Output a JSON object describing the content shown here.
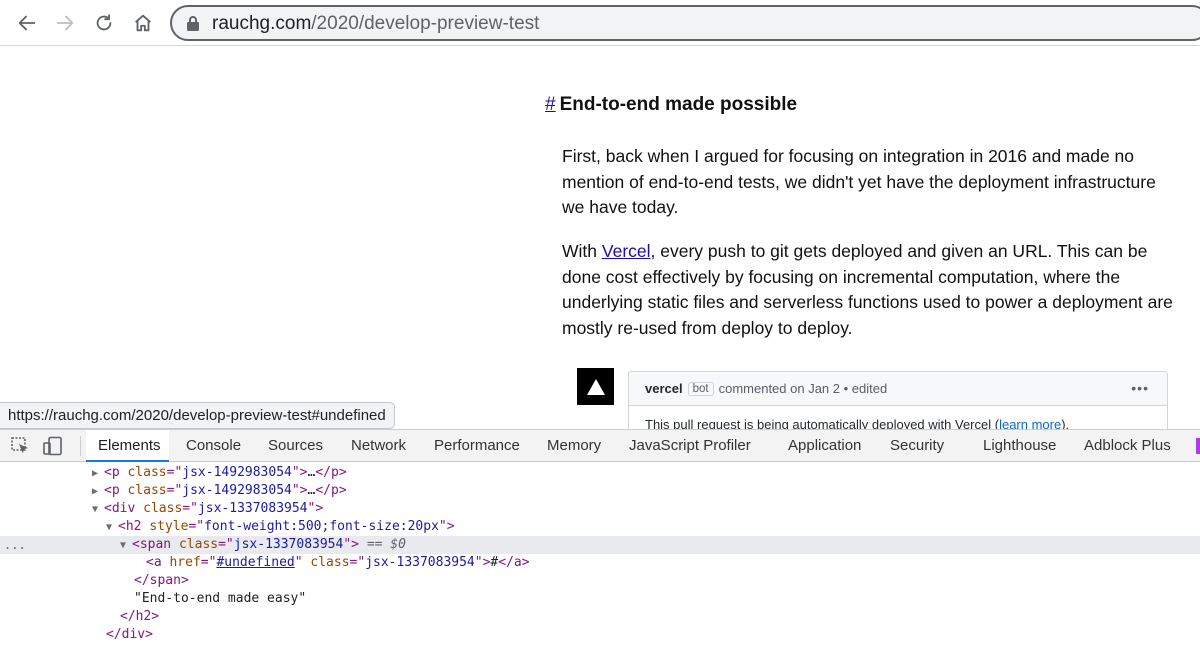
{
  "browser": {
    "url_host": "rauchg.com",
    "url_path": "/2020/develop-preview-test",
    "icons": [
      "back-arrow-icon",
      "forward-arrow-icon",
      "reload-icon",
      "home-icon",
      "lock-icon"
    ]
  },
  "article": {
    "anchor": "#",
    "heading": "End-to-end made possible",
    "p1": "First, back when I argued for focusing on integration in 2016 and made no mention of end-to-end tests, we didn't yet have the deployment infrastructure we have today.",
    "p2_prefix": "With ",
    "p2_link": "Vercel",
    "p2_rest": ", every push to git gets deployed and given an URL. This can be done cost effectively by focusing on incremental computation, where the underlying static files and serverless functions used to power a deployment are mostly re-used from deploy to deploy."
  },
  "comment": {
    "author": "vercel",
    "badge": "bot",
    "meta": "commented on Jan 2 • edited",
    "menu": "•••",
    "body": "This pull request is being automatically deployed with Vercel (",
    "body_link": "learn more",
    "body_end": ")."
  },
  "status_bar": {
    "hover_url": "https://rauchg.com/2020/develop-preview-test#undefined"
  },
  "devtools": {
    "tabs": [
      "Elements",
      "Console",
      "Sources",
      "Network",
      "Performance",
      "Memory",
      "JavaScript Profiler",
      "Application",
      "Security",
      "Lighthouse",
      "Adblock Plus"
    ],
    "active_tab": "Elements",
    "dom": {
      "p1_class": "jsx-1492983054",
      "p2_class": "jsx-1492983054",
      "div_class": "jsx-1337083954",
      "h2_style": "font-weight:500;font-size:20px",
      "span_class": "jsx-1337083954",
      "selected_marker": "== $0",
      "a_href": "#undefined",
      "a_class": "jsx-1337083954",
      "a_text": "#",
      "h2_text": "\"End-to-end made easy\"",
      "ellipsis": "…",
      "gutter": "..."
    }
  },
  "colors": {
    "link": "#1a0dab",
    "devtools_active": "#1a73e8",
    "tag": "#881280",
    "attr_name": "#994500",
    "attr_value": "#1a1aa6"
  }
}
